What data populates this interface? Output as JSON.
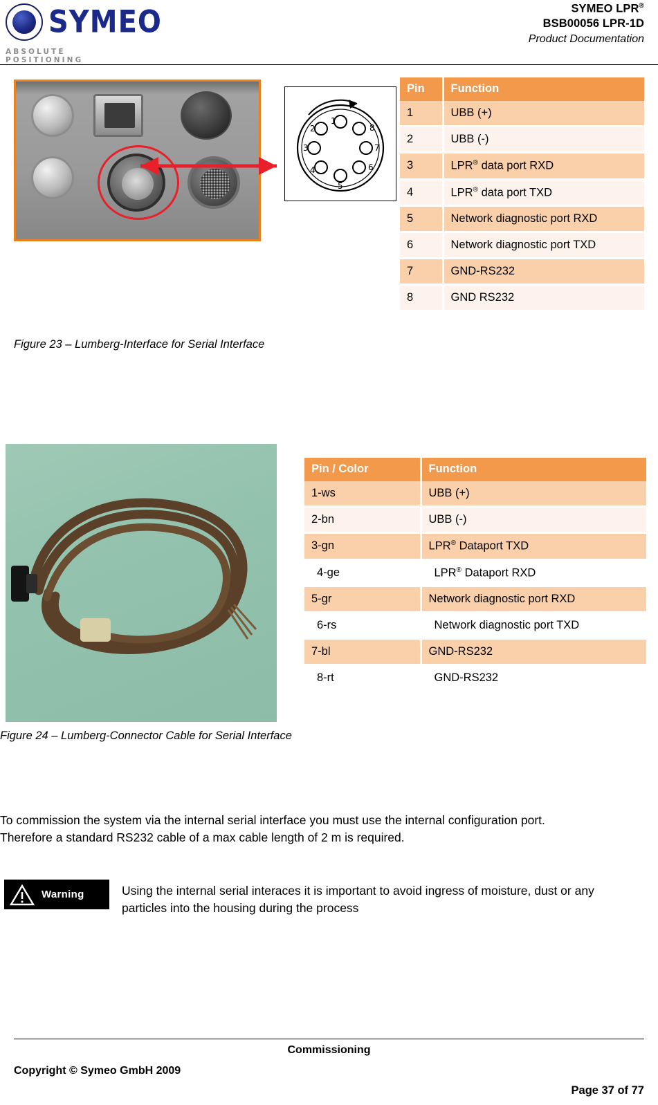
{
  "header": {
    "logo_word": "SYMEO",
    "logo_tagline": "ABSOLUTE POSITIONING",
    "title_line1": "SYMEO LPR",
    "title_line1_sup": "®",
    "title_line2": "BSB00056 LPR-1D",
    "title_line3": "Product Documentation"
  },
  "figure23": {
    "caption": "Figure 23 – Lumberg-Interface for Serial Interface",
    "photo_alt": "lumberg-connector-photo",
    "diagram_alt": "8-pin-connector-pinout-diagram",
    "pin_numbers": [
      "1",
      "2",
      "3",
      "4",
      "5",
      "6",
      "7",
      "8"
    ]
  },
  "figure24": {
    "caption": "Figure 24 – Lumberg-Connector Cable for Serial Interface",
    "photo_alt": "lumberg-cable-photo"
  },
  "table23": {
    "headers": [
      "Pin",
      "Function"
    ],
    "rows": [
      {
        "pin": "1",
        "function": "UBB (+)",
        "shade": "shade"
      },
      {
        "pin": "2",
        "function": "UBB (-)",
        "shade": "plain"
      },
      {
        "pin": "3",
        "function": "LPR® data port RXD",
        "shade": "shade"
      },
      {
        "pin": "4",
        "function": "LPR® data port TXD",
        "shade": "plain"
      },
      {
        "pin": "5",
        "function": "Network diagnostic port RXD",
        "shade": "shade"
      },
      {
        "pin": "6",
        "function": "Network diagnostic port TXD",
        "shade": "plain"
      },
      {
        "pin": "7",
        "function": "GND-RS232",
        "shade": "shade"
      },
      {
        "pin": "8",
        "function": "GND RS232",
        "shade": "plain"
      }
    ]
  },
  "table24": {
    "headers": [
      "Pin  / Color",
      "Function"
    ],
    "rows": [
      {
        "pin": "1-ws",
        "function": "UBB (+)",
        "shade": "shade"
      },
      {
        "pin": "2-bn",
        "function": "UBB (-)",
        "shade": "plain"
      },
      {
        "pin": "3-gn",
        "function": "LPR® Dataport TXD",
        "shade": "shade"
      },
      {
        "pin": "4-ge",
        "function": "LPR® Dataport RXD",
        "shade": "plain-white"
      },
      {
        "pin": "5-gr",
        "function": "Network diagnostic port RXD",
        "shade": "shade"
      },
      {
        "pin": "6-rs",
        "function": "Network diagnostic port TXD",
        "shade": "plain-white"
      },
      {
        "pin": "7-bl",
        "function": "GND-RS232",
        "shade": "shade"
      },
      {
        "pin": "8-rt",
        "function": "GND-RS232",
        "shade": "plain-white"
      }
    ]
  },
  "body": {
    "paragraph": "To commission the system via the internal serial interface you must use the internal configuration port. Therefore a standard RS232 cable of a max cable length of 2 m is required."
  },
  "warning": {
    "badge_label": "Warning",
    "icon": "warning-triangle-icon",
    "text": "Using the internal serial interaces it is important to avoid ingress of moisture, dust or any particles into the housing during the process"
  },
  "footer": {
    "section": "Commissioning",
    "copyright": "Copyright © Symeo GmbH 2009",
    "page": "Page 37 of 77"
  },
  "colors": {
    "table_header_bg": "#f2994b",
    "table_shade_bg": "#fad0ab",
    "table_plain_bg": "#fdf3ec",
    "accent_orange": "#e8821e",
    "annotation_red": "#e8202a",
    "logo_blue": "#1b2a8a"
  }
}
